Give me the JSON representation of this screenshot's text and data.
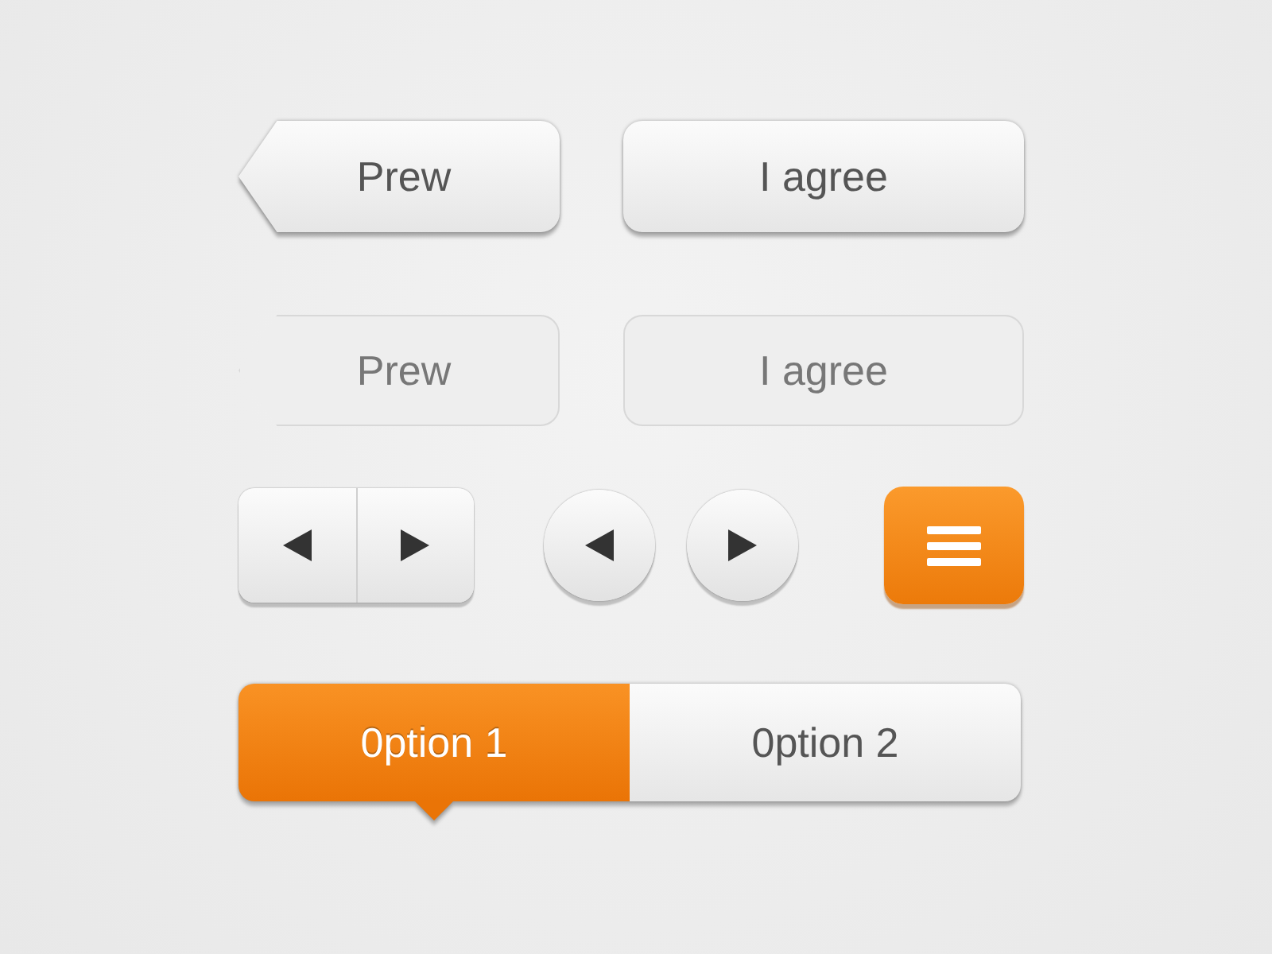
{
  "buttons": [
    {
      "kind": "back",
      "label": "Prew",
      "pressed": false
    },
    {
      "kind": "plain",
      "label": "I agree",
      "pressed": false
    },
    {
      "kind": "back",
      "label": "Prew",
      "pressed": true
    },
    {
      "kind": "plain",
      "label": "I agree",
      "pressed": true
    }
  ],
  "nav_controls": [
    {
      "kind": "pair"
    },
    {
      "kind": "round"
    },
    {
      "kind": "menu"
    }
  ],
  "segmented": [
    {
      "label": "0ption 1",
      "selected": true
    },
    {
      "label": "0ption 2",
      "selected": false
    }
  ]
}
